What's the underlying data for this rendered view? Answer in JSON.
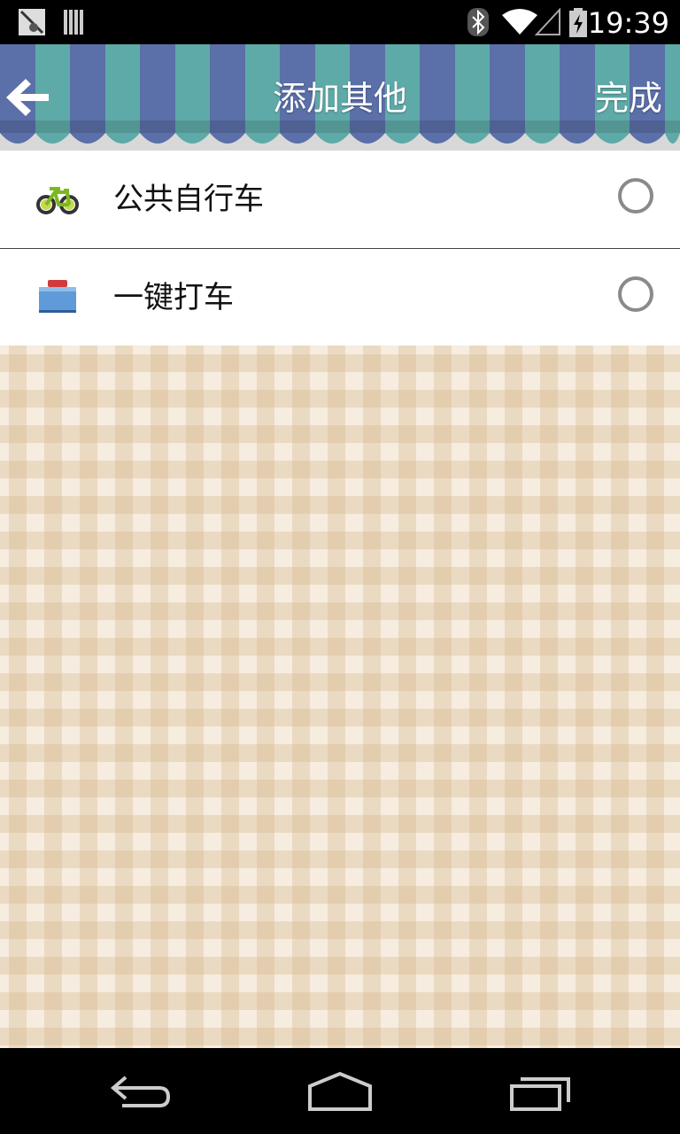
{
  "status_bar": {
    "time": "19:39",
    "icons": [
      "notification-app-icon",
      "notification-barcode-icon",
      "bluetooth-icon",
      "wifi-icon",
      "cell-signal-icon",
      "battery-charging-icon"
    ]
  },
  "header": {
    "title": "添加其他",
    "done_label": "完成",
    "back_icon": "back-arrow-icon",
    "stripe_colors": [
      "#5b6fa8",
      "#5eaaa8"
    ]
  },
  "list": {
    "items": [
      {
        "label": "公共自行车",
        "icon": "bicycle-icon",
        "selected": false
      },
      {
        "label": "一键打车",
        "icon": "taxi-button-icon",
        "selected": false
      }
    ]
  },
  "nav_bar": {
    "icons": [
      "back-nav-icon",
      "home-nav-icon",
      "recent-apps-icon"
    ]
  }
}
